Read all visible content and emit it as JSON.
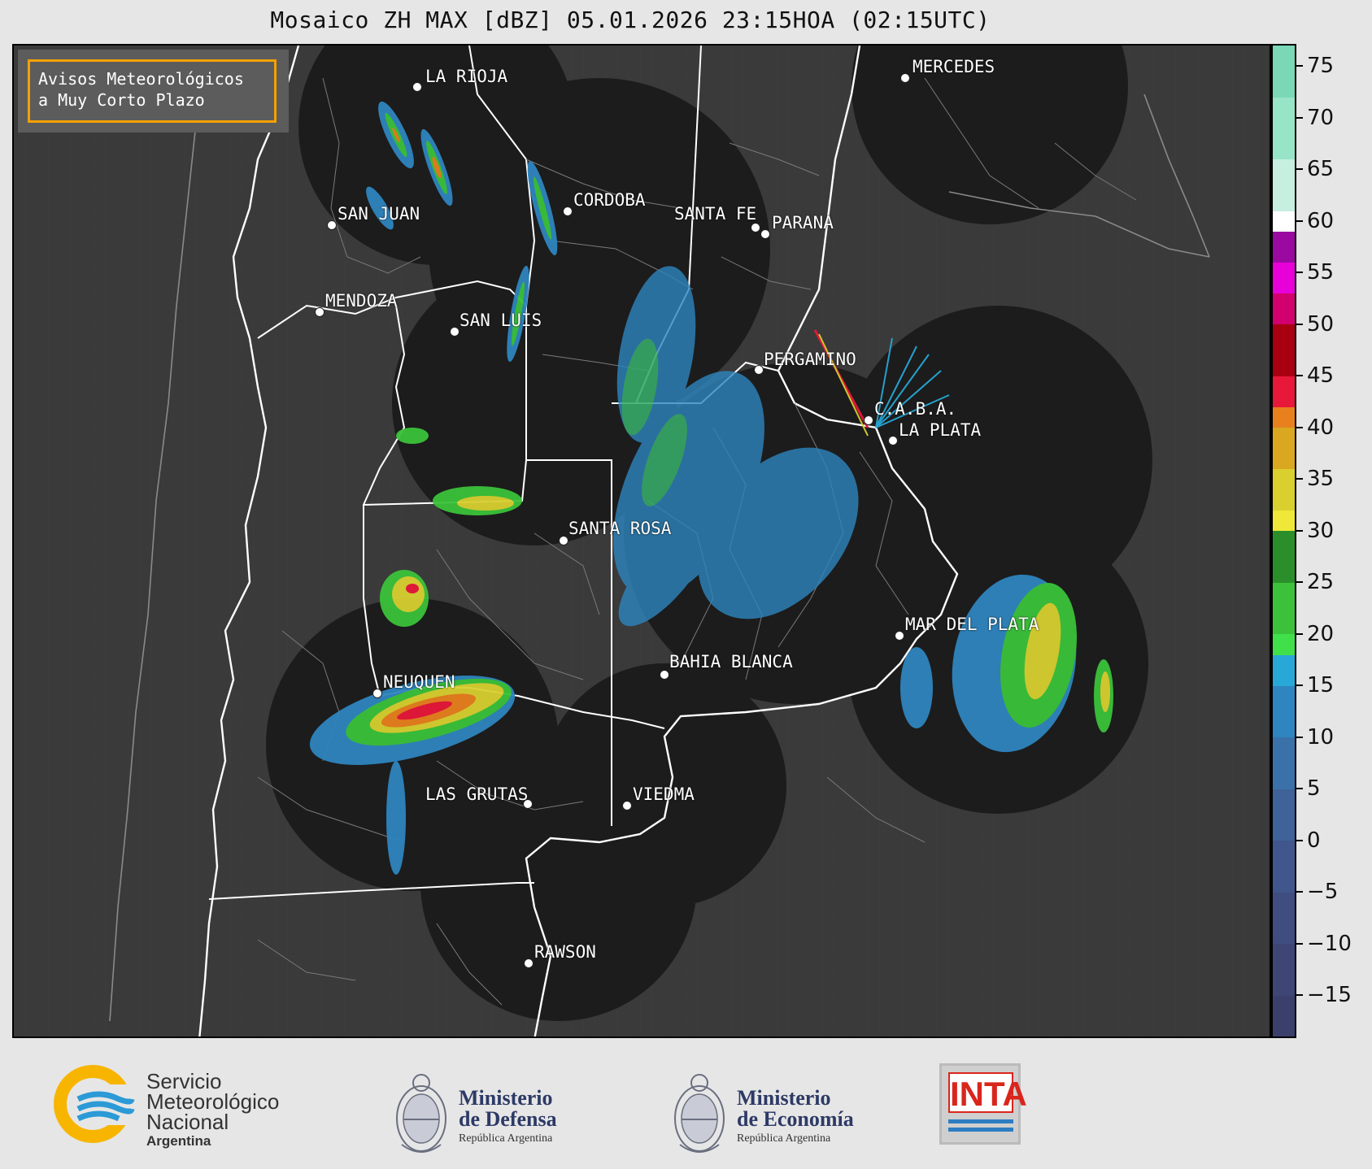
{
  "title": "Mosaico ZH MAX [dBZ] 05.01.2026 23:15HOA (02:15UTC)",
  "notice": {
    "line1": "Avisos Meteorológicos",
    "line2": "a Muy Corto Plazo"
  },
  "cities": [
    {
      "name": "LA RIOJA"
    },
    {
      "name": "MERCEDES"
    },
    {
      "name": "CORDOBA"
    },
    {
      "name": "SAN JUAN"
    },
    {
      "name": "SANTA FE"
    },
    {
      "name": "PARANA"
    },
    {
      "name": "MENDOZA"
    },
    {
      "name": "SAN LUIS"
    },
    {
      "name": "PERGAMINO"
    },
    {
      "name": "C.A.B.A."
    },
    {
      "name": "LA PLATA"
    },
    {
      "name": "SANTA ROSA"
    },
    {
      "name": "MAR DEL PLATA"
    },
    {
      "name": "BAHIA BLANCA"
    },
    {
      "name": "NEUQUEN"
    },
    {
      "name": "LAS GRUTAS"
    },
    {
      "name": "VIEDMA"
    },
    {
      "name": "RAWSON"
    }
  ],
  "colorbar": {
    "unit": "dBZ",
    "min": -19,
    "max": 77,
    "ticks": [
      "75",
      "70",
      "65",
      "60",
      "55",
      "50",
      "45",
      "40",
      "35",
      "30",
      "25",
      "20",
      "15",
      "10",
      "5",
      "0",
      "−5",
      "−10",
      "−15"
    ],
    "tick_values": [
      75,
      70,
      65,
      60,
      55,
      50,
      45,
      40,
      35,
      30,
      25,
      20,
      15,
      10,
      5,
      0,
      -5,
      -10,
      -15
    ],
    "bands": [
      {
        "from": -19,
        "to": -15,
        "color": "#3b3f6b"
      },
      {
        "from": -15,
        "to": -10,
        "color": "#3e4676"
      },
      {
        "from": -10,
        "to": -5,
        "color": "#3f4d80"
      },
      {
        "from": -5,
        "to": 0,
        "color": "#40568c"
      },
      {
        "from": 0,
        "to": 5,
        "color": "#3f6299"
      },
      {
        "from": 5,
        "to": 10,
        "color": "#3a71a8"
      },
      {
        "from": 10,
        "to": 15,
        "color": "#2f85bf"
      },
      {
        "from": 15,
        "to": 18,
        "color": "#28a8d6"
      },
      {
        "from": 18,
        "to": 20,
        "color": "#3fe04a"
      },
      {
        "from": 20,
        "to": 25,
        "color": "#3cc23a"
      },
      {
        "from": 25,
        "to": 30,
        "color": "#2a8f2a"
      },
      {
        "from": 30,
        "to": 32,
        "color": "#efe838"
      },
      {
        "from": 32,
        "to": 36,
        "color": "#d9d030"
      },
      {
        "from": 36,
        "to": 40,
        "color": "#d9a820"
      },
      {
        "from": 40,
        "to": 42,
        "color": "#e8801e"
      },
      {
        "from": 42,
        "to": 45,
        "color": "#e8183a"
      },
      {
        "from": 45,
        "to": 50,
        "color": "#a80010"
      },
      {
        "from": 50,
        "to": 53,
        "color": "#d2006e"
      },
      {
        "from": 53,
        "to": 56,
        "color": "#e800d8"
      },
      {
        "from": 56,
        "to": 59,
        "color": "#9a0aa0"
      },
      {
        "from": 59,
        "to": 61,
        "color": "#ffffff"
      },
      {
        "from": 61,
        "to": 66,
        "color": "#c6efe0"
      },
      {
        "from": 66,
        "to": 72,
        "color": "#98e4c6"
      },
      {
        "from": 72,
        "to": 77,
        "color": "#7ad8b6"
      }
    ]
  },
  "footer": {
    "smn_line1": "Servicio",
    "smn_line2": "Meteorológico",
    "smn_line3": "Nacional",
    "smn_line4": "Argentina",
    "defensa_line1": "Ministerio",
    "defensa_line2": "de Defensa",
    "defensa_line3": "República Argentina",
    "economia_line1": "Ministerio",
    "economia_line2": "de Economía",
    "economia_line3": "República Argentina",
    "inta": "INTA"
  }
}
